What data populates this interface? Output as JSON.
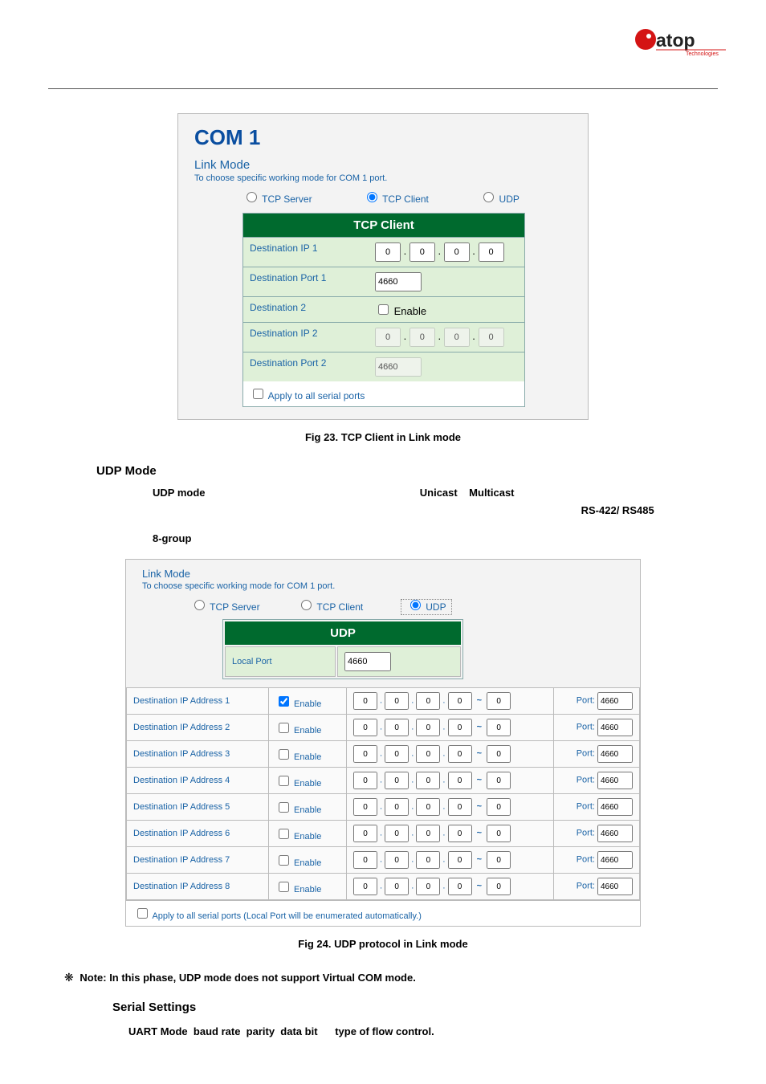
{
  "logo": {
    "brand": "atop",
    "tag": "Technologies"
  },
  "com": {
    "title": "COM 1",
    "link_mode": "Link Mode",
    "link_sub": "To choose specific working mode for COM 1 port.",
    "radios": {
      "server": "TCP Server",
      "client": "TCP Client",
      "udp": "UDP"
    },
    "tcp_client": {
      "header": "TCP Client",
      "rows": [
        {
          "label": "Destination IP 1",
          "type": "ip",
          "v": [
            "0",
            "0",
            "0",
            "0"
          ]
        },
        {
          "label": "Destination Port 1",
          "type": "text",
          "v": "4660"
        },
        {
          "label": "Destination 2",
          "type": "check",
          "v": "Enable"
        },
        {
          "label": "Destination IP 2",
          "type": "ip",
          "v": [
            "0",
            "0",
            "0",
            "0"
          ],
          "disabled": true
        },
        {
          "label": "Destination Port 2",
          "type": "text",
          "v": "4660",
          "disabled": true
        }
      ],
      "apply": "Apply to all serial ports"
    }
  },
  "fig23": "Fig 23. TCP Client in Link mode",
  "udp_mode": {
    "heading": "UDP Mode",
    "p1a": "UDP mode",
    "p1b": "Unicast",
    "p1c": "Multicast",
    "p1d": "RS-422/ RS485",
    "p2": "8-group"
  },
  "udp_box": {
    "link_mode": "Link Mode",
    "link_sub": "To choose specific working mode for COM 1 port.",
    "radios": {
      "server": "TCP Server",
      "client": "TCP Client",
      "udp": "UDP"
    },
    "header": "UDP",
    "local_port_label": "Local Port",
    "local_port_value": "4660",
    "enable": "Enable",
    "port_label": "Port:",
    "port_value": "4660",
    "rows": [
      {
        "label": "Destination IP Address 1",
        "checked": true
      },
      {
        "label": "Destination IP Address 2",
        "checked": false
      },
      {
        "label": "Destination IP Address 3",
        "checked": false
      },
      {
        "label": "Destination IP Address 4",
        "checked": false
      },
      {
        "label": "Destination IP Address 5",
        "checked": false
      },
      {
        "label": "Destination IP Address 6",
        "checked": false
      },
      {
        "label": "Destination IP Address 7",
        "checked": false
      },
      {
        "label": "Destination IP Address 8",
        "checked": false
      }
    ],
    "apply": "Apply to all serial ports (Local Port will be enumerated automatically.)"
  },
  "fig24": "Fig 24. UDP protocol in Link mode",
  "note": "Note: In this phase, UDP mode does not support Virtual COM mode.",
  "serial": {
    "heading": "Serial Settings",
    "p_a": "UART Mode",
    "p_b": "baud rate",
    "p_c": "parity",
    "p_d": "data bit",
    "p_e": "type of flow control."
  }
}
